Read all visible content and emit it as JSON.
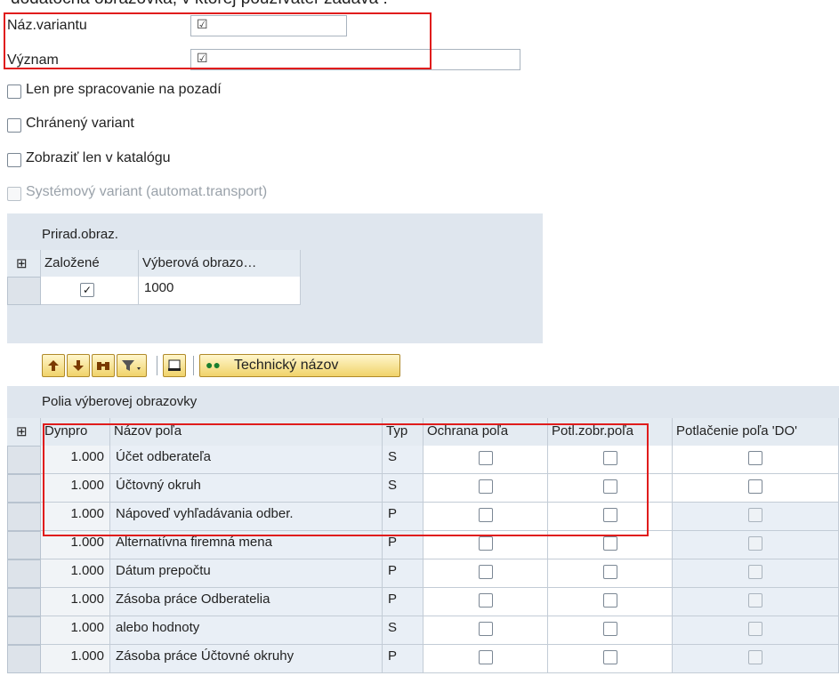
{
  "caption": "dodatočná obrazovka, v ktorej používateľ zadáva :",
  "attributes": {
    "variant_name_label": "Náz.variantu",
    "meaning_label": "Význam"
  },
  "flags": [
    {
      "label": "Len pre spracovanie na pozadí",
      "checked": false,
      "enabled": true
    },
    {
      "label": "Chránený variant",
      "checked": false,
      "enabled": true
    },
    {
      "label": "Zobraziť len v katalógu",
      "checked": false,
      "enabled": true
    },
    {
      "label": "Systémový variant (automat.transport)",
      "checked": false,
      "enabled": false
    }
  ],
  "screen_assignment": {
    "title": "Prirad.obraz.",
    "columns": [
      "Založené",
      "Výberová obrazo…"
    ],
    "rows": [
      {
        "created": true,
        "screen": "1000"
      }
    ]
  },
  "toolbar": {
    "icons": [
      "sort-ascending-icon",
      "sort-descending-icon",
      "find-icon",
      "filter-icon",
      "print-icon"
    ],
    "technical_name_label": "Technický názov"
  },
  "fields_table": {
    "title": "Polia výberovej obrazovky",
    "columns": [
      "Dynpro",
      "Názov poľa",
      "Typ",
      "Ochrana poľa",
      "Potl.zobr.poľa",
      "Potlačenie poľa 'DO'"
    ],
    "rows": [
      {
        "dynpro": "1.000",
        "name": "Účet odberateľa",
        "type": "S"
      },
      {
        "dynpro": "1.000",
        "name": "Účtovný okruh",
        "type": "S"
      },
      {
        "dynpro": "1.000",
        "name": "Nápoveď vyhľadávania odber.",
        "type": "P"
      },
      {
        "dynpro": "1.000",
        "name": "Alternatívna firemná mena",
        "type": "P"
      },
      {
        "dynpro": "1.000",
        "name": "Dátum prepočtu",
        "type": "P"
      },
      {
        "dynpro": "1.000",
        "name": "Zásoba práce Odberatelia",
        "type": "P"
      },
      {
        "dynpro": "1.000",
        "name": "alebo hodnoty",
        "type": "S"
      },
      {
        "dynpro": "1.000",
        "name": "Zásoba práce Účtovné okruhy",
        "type": "P"
      }
    ]
  },
  "colors": {
    "highlight": "#e01c1c",
    "panel": "#dfe6ee"
  }
}
